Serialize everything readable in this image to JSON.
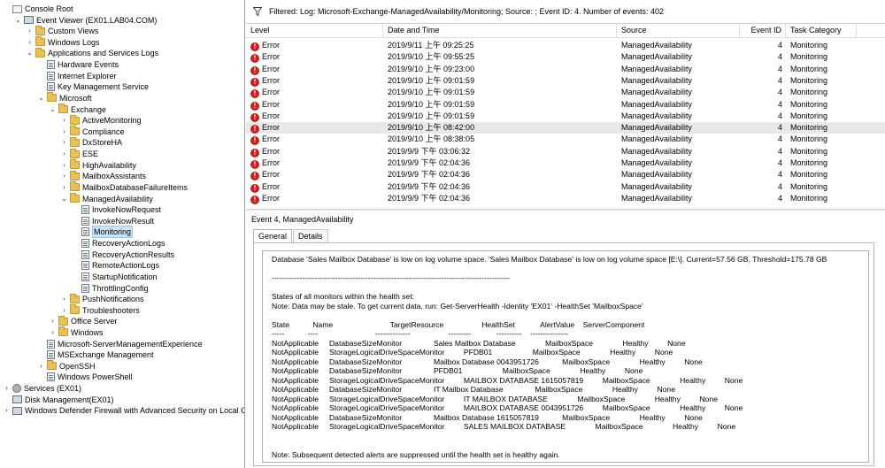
{
  "tree": [
    {
      "label": "Console Root",
      "icon": "root",
      "exp": "",
      "lvl": 0
    },
    {
      "label": "Event Viewer (EX01.LAB04.COM)",
      "icon": "app",
      "exp": "⌄",
      "lvl": 1
    },
    {
      "label": "Custom Views",
      "icon": "folder",
      "exp": "›",
      "lvl": 2
    },
    {
      "label": "Windows Logs",
      "icon": "folder",
      "exp": "›",
      "lvl": 2
    },
    {
      "label": "Applications and Services Logs",
      "icon": "folder",
      "exp": "⌄",
      "lvl": 2
    },
    {
      "label": "Hardware Events",
      "icon": "log",
      "exp": "",
      "lvl": 3
    },
    {
      "label": "Internet Explorer",
      "icon": "log",
      "exp": "",
      "lvl": 3
    },
    {
      "label": "Key Management Service",
      "icon": "log",
      "exp": "",
      "lvl": 3
    },
    {
      "label": "Microsoft",
      "icon": "folder",
      "exp": "⌄",
      "lvl": 3
    },
    {
      "label": "Exchange",
      "icon": "folder",
      "exp": "⌄",
      "lvl": 4
    },
    {
      "label": "ActiveMonitoring",
      "icon": "folder",
      "exp": "›",
      "lvl": 5
    },
    {
      "label": "Compliance",
      "icon": "folder",
      "exp": "›",
      "lvl": 5
    },
    {
      "label": "DxStoreHA",
      "icon": "folder",
      "exp": "›",
      "lvl": 5
    },
    {
      "label": "ESE",
      "icon": "folder",
      "exp": "›",
      "lvl": 5
    },
    {
      "label": "HighAvailability",
      "icon": "folder",
      "exp": "›",
      "lvl": 5
    },
    {
      "label": "MailboxAssistants",
      "icon": "folder",
      "exp": "›",
      "lvl": 5
    },
    {
      "label": "MailboxDatabaseFailureItems",
      "icon": "folder",
      "exp": "›",
      "lvl": 5
    },
    {
      "label": "ManagedAvailability",
      "icon": "folder",
      "exp": "⌄",
      "lvl": 5
    },
    {
      "label": "InvokeNowRequest",
      "icon": "log",
      "exp": "",
      "lvl": 6
    },
    {
      "label": "InvokeNowResult",
      "icon": "log",
      "exp": "",
      "lvl": 6
    },
    {
      "label": "Monitoring",
      "icon": "log",
      "exp": "",
      "lvl": 6,
      "sel": true
    },
    {
      "label": "RecoveryActionLogs",
      "icon": "log",
      "exp": "",
      "lvl": 6
    },
    {
      "label": "RecoveryActionResults",
      "icon": "log",
      "exp": "",
      "lvl": 6
    },
    {
      "label": "RemoteActionLogs",
      "icon": "log",
      "exp": "",
      "lvl": 6
    },
    {
      "label": "StartupNotification",
      "icon": "log",
      "exp": "",
      "lvl": 6
    },
    {
      "label": "ThrottlingConfig",
      "icon": "log",
      "exp": "",
      "lvl": 6
    },
    {
      "label": "PushNotifications",
      "icon": "folder",
      "exp": "›",
      "lvl": 5
    },
    {
      "label": "Troubleshooters",
      "icon": "folder",
      "exp": "›",
      "lvl": 5
    },
    {
      "label": "Office Server",
      "icon": "folder",
      "exp": "›",
      "lvl": 4
    },
    {
      "label": "Windows",
      "icon": "folder",
      "exp": "›",
      "lvl": 4
    },
    {
      "label": "Microsoft-ServerManagementExperience",
      "icon": "log",
      "exp": "",
      "lvl": 3
    },
    {
      "label": "MSExchange Management",
      "icon": "log",
      "exp": "",
      "lvl": 3
    },
    {
      "label": "OpenSSH",
      "icon": "folder",
      "exp": "›",
      "lvl": 3
    },
    {
      "label": "Windows PowerShell",
      "icon": "log",
      "exp": "",
      "lvl": 3
    },
    {
      "label": "Services (EX01)",
      "icon": "gear",
      "exp": "›",
      "lvl": 0
    },
    {
      "label": "Disk Management(EX01)",
      "icon": "app",
      "exp": "",
      "lvl": 0
    },
    {
      "label": "Windows Defender Firewall with Advanced Security on Local Com",
      "icon": "app",
      "exp": "›",
      "lvl": 0
    }
  ],
  "filter_text": "Filtered: Log: Microsoft-Exchange-ManagedAvailability/Monitoring; Source: ; Event ID: 4. Number of events: 402",
  "columns": [
    "Level",
    "Date and Time",
    "Source",
    "Event ID",
    "Task Category"
  ],
  "events": [
    {
      "level": "Error",
      "datetime": "2019/9/11 上午 09:25:25",
      "source": "ManagedAvailability",
      "event_id": "4",
      "task": "Monitoring"
    },
    {
      "level": "Error",
      "datetime": "2019/9/10 上午 09:55:25",
      "source": "ManagedAvailability",
      "event_id": "4",
      "task": "Monitoring"
    },
    {
      "level": "Error",
      "datetime": "2019/9/10 上午 09:23:00",
      "source": "ManagedAvailability",
      "event_id": "4",
      "task": "Monitoring"
    },
    {
      "level": "Error",
      "datetime": "2019/9/10 上午 09:01:59",
      "source": "ManagedAvailability",
      "event_id": "4",
      "task": "Monitoring"
    },
    {
      "level": "Error",
      "datetime": "2019/9/10 上午 09:01:59",
      "source": "ManagedAvailability",
      "event_id": "4",
      "task": "Monitoring"
    },
    {
      "level": "Error",
      "datetime": "2019/9/10 上午 09:01:59",
      "source": "ManagedAvailability",
      "event_id": "4",
      "task": "Monitoring"
    },
    {
      "level": "Error",
      "datetime": "2019/9/10 上午 09:01:59",
      "source": "ManagedAvailability",
      "event_id": "4",
      "task": "Monitoring"
    },
    {
      "level": "Error",
      "datetime": "2019/9/10 上午 08:42:00",
      "source": "ManagedAvailability",
      "event_id": "4",
      "task": "Monitoring",
      "selected": true
    },
    {
      "level": "Error",
      "datetime": "2019/9/10 上午 08:38:05",
      "source": "ManagedAvailability",
      "event_id": "4",
      "task": "Monitoring"
    },
    {
      "level": "Error",
      "datetime": "2019/9/9 下午 03:06:32",
      "source": "ManagedAvailability",
      "event_id": "4",
      "task": "Monitoring"
    },
    {
      "level": "Error",
      "datetime": "2019/9/9 下午 02:04:36",
      "source": "ManagedAvailability",
      "event_id": "4",
      "task": "Monitoring"
    },
    {
      "level": "Error",
      "datetime": "2019/9/9 下午 02:04:36",
      "source": "ManagedAvailability",
      "event_id": "4",
      "task": "Monitoring"
    },
    {
      "level": "Error",
      "datetime": "2019/9/9 下午 02:04:36",
      "source": "ManagedAvailability",
      "event_id": "4",
      "task": "Monitoring"
    },
    {
      "level": "Error",
      "datetime": "2019/9/9 下午 02:04:36",
      "source": "ManagedAvailability",
      "event_id": "4",
      "task": "Monitoring"
    }
  ],
  "detail_title": "Event 4, ManagedAvailability",
  "tabs": [
    "General",
    "Details"
  ],
  "message_lines": [
    "Database 'Sales Mailbox Database' is low on log volume space. 'Sales Mailbox Database' is low on log volume space [E:\\]. Current=57.56 GB, Threshold=175.78 GB",
    "",
    "----------------------------------------------------------------------------------------------",
    "",
    "States of all monitors within the health set:",
    "Note: Data may be stale. To get current data, run: Get-ServerHealth -Identity 'EX01' -HealthSet 'MailboxSpace'",
    "",
    "State           Name                           TargetResource                  HealthSet            AlertValue    ServerComponent",
    "-----           ----                           --------------                  ---------            ----------    ---------------",
    "NotApplicable     DatabaseSizeMonitor               Sales Mailbox Database              MailboxSpace              Healthy         None",
    "NotApplicable     StorageLogicalDriveSpaceMonitor         PFDB01                   MailboxSpace              Healthy         None",
    "NotApplicable     DatabaseSizeMonitor               Mailbox Database 0043951726           MailboxSpace              Healthy         None",
    "NotApplicable     DatabaseSizeMonitor               PFDB01                   MailboxSpace              Healthy         None",
    "NotApplicable     StorageLogicalDriveSpaceMonitor         MAILBOX DATABASE 1615057819         MailboxSpace              Healthy         None",
    "NotApplicable     DatabaseSizeMonitor               IT Mailbox Database               MailboxSpace              Healthy         None",
    "NotApplicable     StorageLogicalDriveSpaceMonitor         IT MAILBOX DATABASE              MailboxSpace              Healthy         None",
    "NotApplicable     StorageLogicalDriveSpaceMonitor         MAILBOX DATABASE 0043951726         MailboxSpace              Healthy         None",
    "NotApplicable     DatabaseSizeMonitor               Mailbox Database 1615057819           MailboxSpace              Healthy         None",
    "NotApplicable     StorageLogicalDriveSpaceMonitor         SALES MAILBOX DATABASE              MailboxSpace              Healthy         None",
    "",
    "",
    "Note: Subsequent detected alerts are suppressed until the health set is healthy again."
  ]
}
